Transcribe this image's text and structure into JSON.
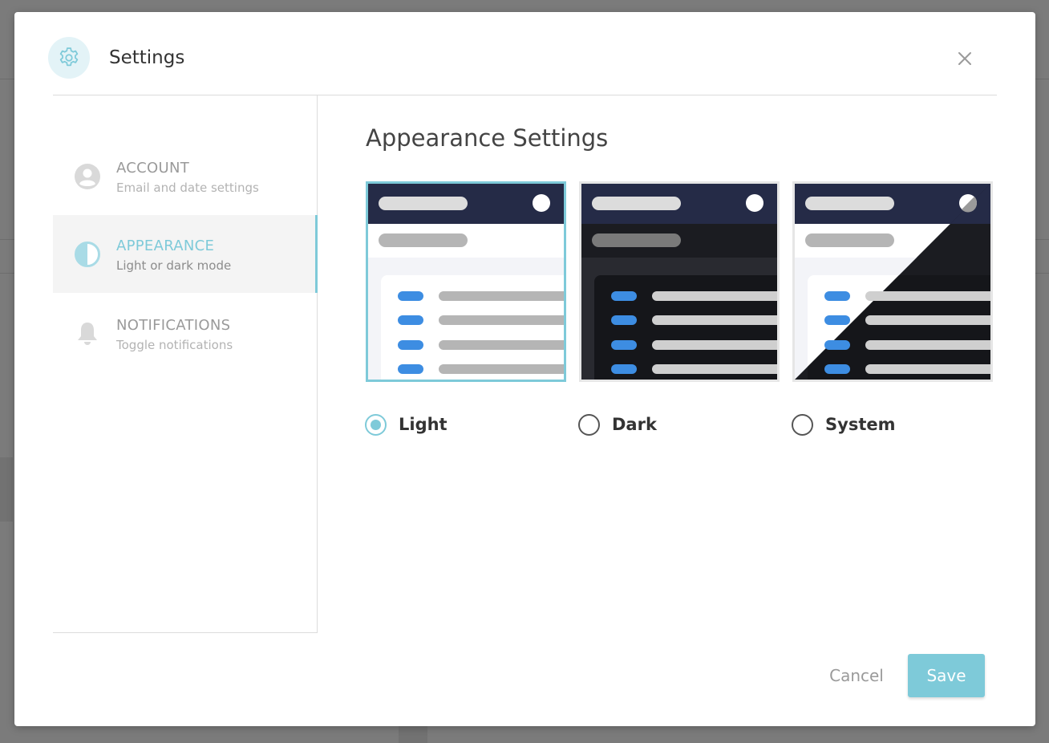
{
  "dialog": {
    "title": "Settings",
    "icon": "gear-icon",
    "close_icon": "close-icon"
  },
  "sidebar": {
    "items": [
      {
        "id": "account",
        "title": "ACCOUNT",
        "subtitle": "Email and date settings",
        "icon": "user-circle-icon",
        "active": false
      },
      {
        "id": "appearance",
        "title": "APPEARANCE",
        "subtitle": "Light or dark mode",
        "icon": "contrast-icon",
        "active": true
      },
      {
        "id": "notifications",
        "title": "NOTIFICATIONS",
        "subtitle": "Toggle notifications",
        "icon": "bell-icon",
        "active": false
      }
    ]
  },
  "main": {
    "title": "Appearance Settings",
    "options": [
      {
        "id": "light",
        "label": "Light",
        "selected": true
      },
      {
        "id": "dark",
        "label": "Dark",
        "selected": false
      },
      {
        "id": "system",
        "label": "System",
        "selected": false
      }
    ]
  },
  "footer": {
    "cancel_label": "Cancel",
    "save_label": "Save"
  },
  "colors": {
    "accent": "#7ecad9",
    "navy": "#252b47",
    "dark_bg": "#1b1c21",
    "pill_blue": "#3d8de2"
  }
}
